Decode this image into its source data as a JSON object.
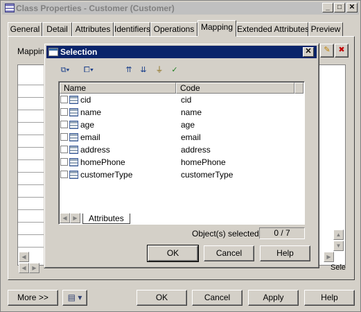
{
  "window": {
    "title": "Class Properties - Customer (Customer)",
    "min": "_",
    "max": "□",
    "close": "✕"
  },
  "tabs": [
    "General",
    "Detail",
    "Attributes",
    "Identifiers",
    "Operations",
    "Mapping",
    "Extended Attributes",
    "Preview"
  ],
  "active_tab": "Mapping",
  "panel": {
    "mapping_label": "Mapping",
    "bottom_tab": "Sele"
  },
  "dialog": {
    "title": "Selection",
    "close": "✕",
    "columns": {
      "name": "Name",
      "code": "Code"
    },
    "rows": [
      {
        "name": "cid",
        "code": "cid"
      },
      {
        "name": "name",
        "code": "name"
      },
      {
        "name": "age",
        "code": "age"
      },
      {
        "name": "email",
        "code": "email"
      },
      {
        "name": "address",
        "code": "address"
      },
      {
        "name": "homePhone",
        "code": "homePhone"
      },
      {
        "name": "customerType",
        "code": "customerType"
      }
    ],
    "sheet_tab": "Attributes",
    "selected_label": "Object(s) selected:",
    "selected_count": "0 / 7",
    "ok": "OK",
    "cancel": "Cancel",
    "help": "Help"
  },
  "footer": {
    "more": "More >>",
    "ok": "OK",
    "cancel": "Cancel",
    "apply": "Apply",
    "help": "Help"
  }
}
